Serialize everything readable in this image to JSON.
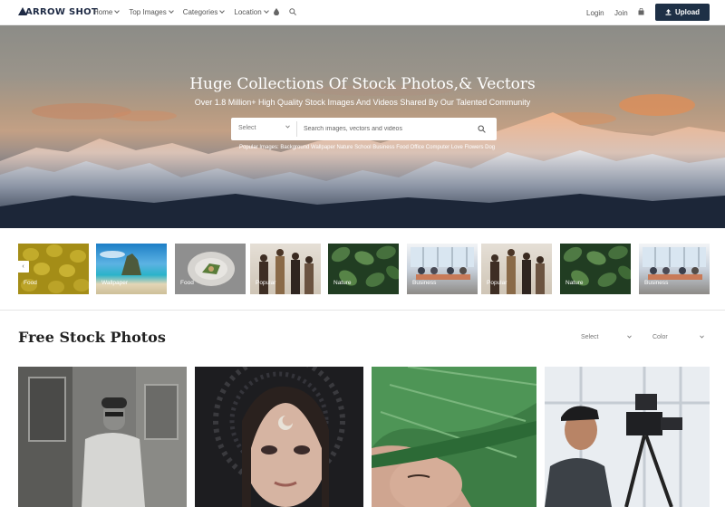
{
  "brand": {
    "logo_text": "ARROW SHOT",
    "accent": "#1e3046"
  },
  "nav": {
    "menu": [
      "Home",
      "Top Images",
      "Categories",
      "Location"
    ],
    "icons": [
      "drop-icon",
      "search-icon",
      "bag-icon"
    ],
    "login": "Login",
    "join": "Join",
    "upload": "Upload"
  },
  "hero": {
    "title": "Huge Collections Of Stock Photos,& Vectors",
    "subtitle": "Over 1.8 Million+ High Quality Stock Images And Videos Shared By Our Talented Community",
    "search": {
      "select_value": "Select",
      "placeholder": "Search images, vectors and videos"
    },
    "popular": "Popular Images: Background Wallpaper Nature School Business Food Office Computer Love Flowers Dog"
  },
  "categories": [
    "Food",
    "Wallpaper",
    "Food",
    "Popular",
    "Nature",
    "Business",
    "Popular",
    "Nature",
    "Business"
  ],
  "section": {
    "title": "Free Stock Photos",
    "filters": [
      "Select",
      "Color"
    ]
  }
}
